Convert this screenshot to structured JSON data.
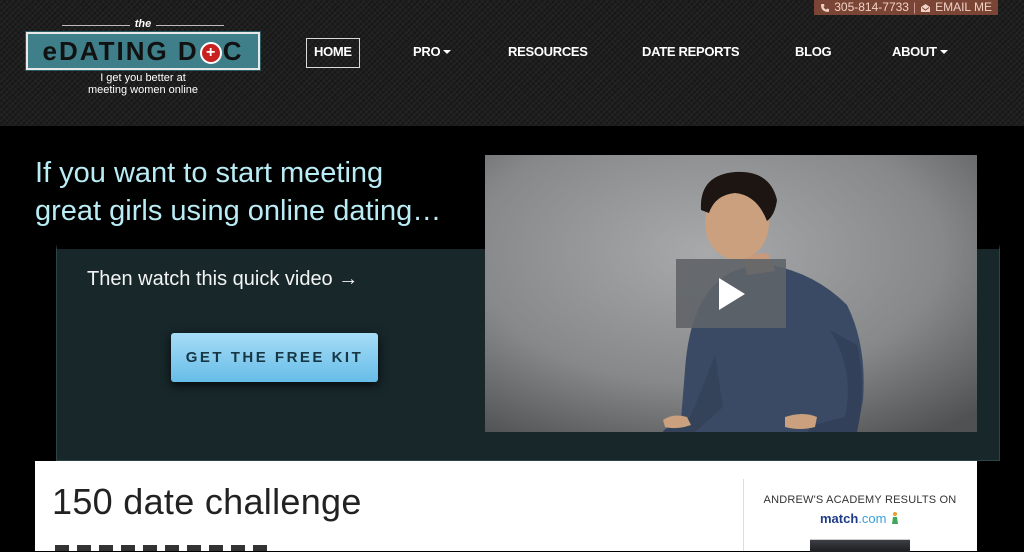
{
  "header": {
    "contact": {
      "phone": "305-814-7733",
      "separator": "|",
      "email_label": "EMAIL ME"
    },
    "logo": {
      "the": "the",
      "name_part1": "eDATING D",
      "name_cross": "+",
      "name_part2": "C",
      "tagline_line1": "I get you better at",
      "tagline_line2": "meeting women online"
    },
    "nav": {
      "home": "HOME",
      "pro": "PRO",
      "resources": "RESOURCES",
      "date_reports": "DATE REPORTS",
      "blog": "BLOG",
      "about": "ABOUT"
    }
  },
  "hero": {
    "title_line1": "If you want to start meeting",
    "title_line2": "great girls using online dating…",
    "panel_text": "Then watch this quick video →",
    "cta_label": "GET THE FREE KIT"
  },
  "content": {
    "title": "150 date challenge",
    "sidebar_heading": "ANDREW'S ACADEMY RESULTS ON",
    "match_brand": "match",
    "match_dotcom": ".com"
  },
  "colors": {
    "accent_teal": "#3f7f8a",
    "hero_text": "#b9ecf4",
    "cta_blue": "#67bde8",
    "contact_bar": "#7a4535"
  },
  "icons": {
    "phone": "phone-icon",
    "email": "email-icon",
    "play": "play-icon",
    "match": "match-person-icon"
  }
}
